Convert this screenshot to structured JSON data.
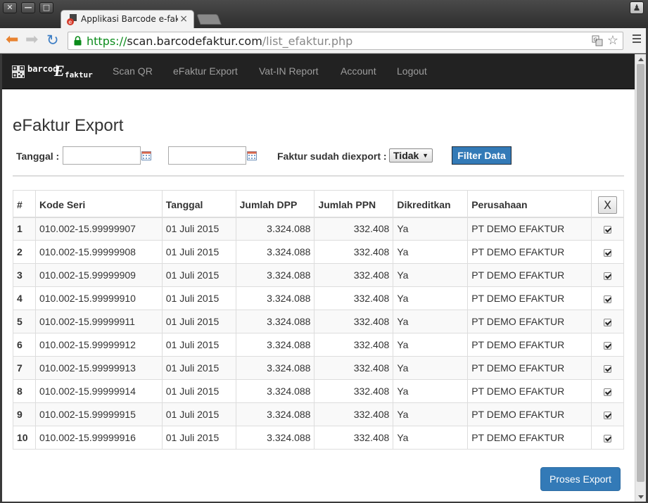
{
  "window": {
    "buttons": [
      "✕",
      "—",
      "□"
    ],
    "profile_glyph": "♟"
  },
  "browser": {
    "tab_title": "Applikasi Barcode e-faktur",
    "tab_close": "×",
    "url_scheme": "https://",
    "url_host": "scan.barcodefaktur.com",
    "url_path": "/list_efaktur.php",
    "back_glyph": "⬅",
    "forward_glyph": "➡",
    "reload_glyph": "↻",
    "star_glyph": "☆"
  },
  "navbar": {
    "brand": {
      "part1": "barcod",
      "part2": "E",
      "part3": "faktur"
    },
    "links": [
      "Scan QR",
      "eFaktur Export",
      "Vat-IN Report",
      "Account",
      "Logout"
    ]
  },
  "page": {
    "title": "eFaktur Export",
    "filter": {
      "tanggal_label": "Tanggal :",
      "date_from": "",
      "date_to": "",
      "exported_label": "Faktur sudah diexport :",
      "exported_value": "Tidak",
      "filter_button": "Filter Data"
    },
    "table": {
      "headers": [
        "#",
        "Kode Seri",
        "Tanggal",
        "Jumlah DPP",
        "Jumlah PPN",
        "Dikreditkan",
        "Perusahaan"
      ],
      "clear_button": "X",
      "rows": [
        {
          "no": "1",
          "kode": "010.002-15.99999907",
          "tanggal": "01 Juli 2015",
          "dpp": "3.324.088",
          "ppn": "332.408",
          "kredit": "Ya",
          "perusahaan": "PT DEMO EFAKTUR",
          "checked": true
        },
        {
          "no": "2",
          "kode": "010.002-15.99999908",
          "tanggal": "01 Juli 2015",
          "dpp": "3.324.088",
          "ppn": "332.408",
          "kredit": "Ya",
          "perusahaan": "PT DEMO EFAKTUR",
          "checked": true
        },
        {
          "no": "3",
          "kode": "010.002-15.99999909",
          "tanggal": "01 Juli 2015",
          "dpp": "3.324.088",
          "ppn": "332.408",
          "kredit": "Ya",
          "perusahaan": "PT DEMO EFAKTUR",
          "checked": true
        },
        {
          "no": "4",
          "kode": "010.002-15.99999910",
          "tanggal": "01 Juli 2015",
          "dpp": "3.324.088",
          "ppn": "332.408",
          "kredit": "Ya",
          "perusahaan": "PT DEMO EFAKTUR",
          "checked": true
        },
        {
          "no": "5",
          "kode": "010.002-15.99999911",
          "tanggal": "01 Juli 2015",
          "dpp": "3.324.088",
          "ppn": "332.408",
          "kredit": "Ya",
          "perusahaan": "PT DEMO EFAKTUR",
          "checked": true
        },
        {
          "no": "6",
          "kode": "010.002-15.99999912",
          "tanggal": "01 Juli 2015",
          "dpp": "3.324.088",
          "ppn": "332.408",
          "kredit": "Ya",
          "perusahaan": "PT DEMO EFAKTUR",
          "checked": true
        },
        {
          "no": "7",
          "kode": "010.002-15.99999913",
          "tanggal": "01 Juli 2015",
          "dpp": "3.324.088",
          "ppn": "332.408",
          "kredit": "Ya",
          "perusahaan": "PT DEMO EFAKTUR",
          "checked": true
        },
        {
          "no": "8",
          "kode": "010.002-15.99999914",
          "tanggal": "01 Juli 2015",
          "dpp": "3.324.088",
          "ppn": "332.408",
          "kredit": "Ya",
          "perusahaan": "PT DEMO EFAKTUR",
          "checked": true
        },
        {
          "no": "9",
          "kode": "010.002-15.99999915",
          "tanggal": "01 Juli 2015",
          "dpp": "3.324.088",
          "ppn": "332.408",
          "kredit": "Ya",
          "perusahaan": "PT DEMO EFAKTUR",
          "checked": true
        },
        {
          "no": "10",
          "kode": "010.002-15.99999916",
          "tanggal": "01 Juli 2015",
          "dpp": "3.324.088",
          "ppn": "332.408",
          "kredit": "Ya",
          "perusahaan": "PT DEMO EFAKTUR",
          "checked": true
        }
      ]
    },
    "export_button": "Proses Export"
  },
  "colors": {
    "navbar_bg": "#222222",
    "nav_link": "#9d9d9d",
    "primary": "#337ab7",
    "url_scheme": "#0b8b1b"
  },
  "icons": [
    "close-window-icon",
    "minimize-icon",
    "maximize-icon",
    "profile-icon",
    "favicon-icon",
    "tab-close-icon",
    "back-arrow-icon",
    "forward-arrow-icon",
    "reload-icon",
    "lock-icon",
    "translate-icon",
    "star-icon",
    "menu-icon",
    "qr-logo-icon",
    "calendar-icon",
    "checkbox-icon"
  ]
}
